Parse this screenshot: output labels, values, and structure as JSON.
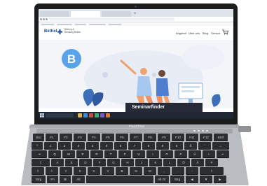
{
  "browser": {
    "tabs": [
      "",
      "",
      ""
    ],
    "url": ""
  },
  "site": {
    "logo_text": "Bethel",
    "logo_subtitle": "Bildung & Beratung Bethel",
    "nav": [
      "Angebot",
      "Über uns",
      "Blog",
      "Service"
    ],
    "accent_color": "#1f4e9c"
  },
  "hero": {
    "badge_letter": "B",
    "badge_color": "#5aa3e8"
  },
  "seminarfinder": {
    "label": "Seminarfinder"
  },
  "taskbar": {
    "tray_text": ""
  },
  "laptop": {
    "brand": "FUJITSU"
  },
  "keyboard": {
    "rows": [
      [
        "Esc",
        "F1",
        "F2",
        "F3",
        "F4",
        "F5",
        "F6",
        "F7",
        "F8",
        "F9",
        "F10",
        "F11",
        "F12",
        "Entf"
      ],
      [
        "^",
        "1",
        "2",
        "3",
        "4",
        "5",
        "6",
        "7",
        "8",
        "9",
        "0",
        "ß",
        "´",
        "←"
      ],
      [
        "⇥",
        "Q",
        "W",
        "E",
        "R",
        "T",
        "Z",
        "U",
        "I",
        "O",
        "P",
        "Ü",
        "+",
        "↵"
      ],
      [
        "⇪",
        "A",
        "S",
        "D",
        "F",
        "G",
        "H",
        "J",
        "K",
        "L",
        "Ö",
        "Ä",
        "#"
      ],
      [
        "⇧",
        "<",
        "Y",
        "X",
        "C",
        "V",
        "B",
        "N",
        "M",
        ",",
        ".",
        "-",
        "⇧"
      ],
      [
        "Strg",
        "Fn",
        "⊞",
        "Alt",
        "",
        "Alt Gr",
        "Strg",
        "◀",
        "▼",
        "▶"
      ]
    ]
  }
}
